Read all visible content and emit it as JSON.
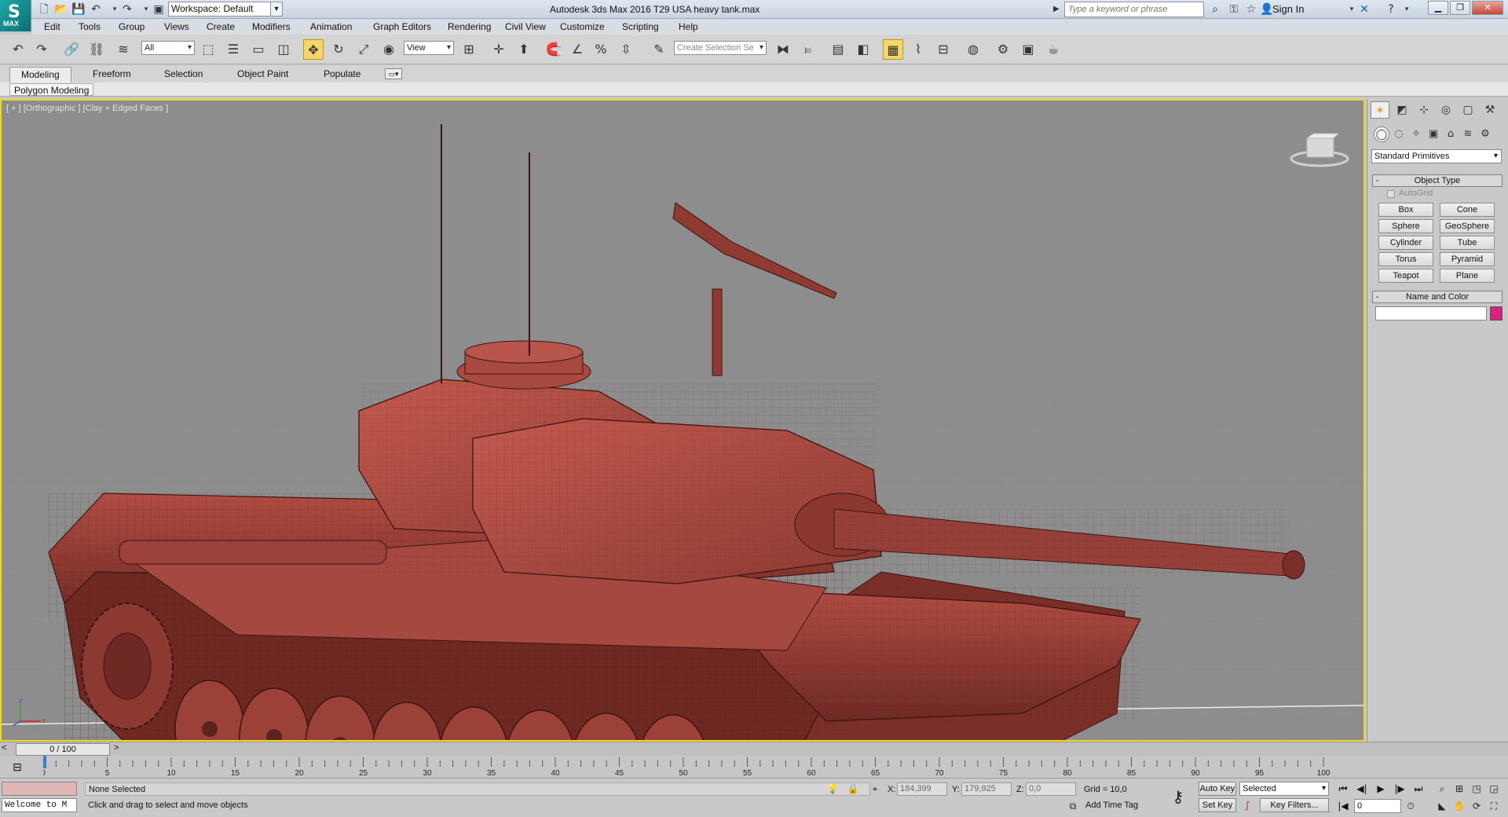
{
  "title_bar": {
    "app_logo": "MAX",
    "workspace": "Workspace: Default",
    "window_title": "Autodesk 3ds Max 2016      T29 USA heavy tank.max",
    "search_placeholder": "Type a keyword or phrase",
    "sign_in": "Sign In"
  },
  "menu": [
    "Edit",
    "Tools",
    "Group",
    "Views",
    "Create",
    "Modifiers",
    "Animation",
    "Graph Editors",
    "Rendering",
    "Civil View",
    "Customize",
    "Scripting",
    "Help"
  ],
  "toolbar": {
    "selection_filter": "All",
    "ref_coord": "View",
    "selection_set_placeholder": "Create Selection Se"
  },
  "ribbon": {
    "tabs": [
      "Modeling",
      "Freeform",
      "Selection",
      "Object Paint",
      "Populate"
    ],
    "active_tab": "Modeling",
    "panel_label": "Polygon Modeling"
  },
  "viewport": {
    "label": "[ + ] [Orthographic ] [Clay + Edged Faces ]",
    "model_color": "#a8463c",
    "background": "#8d8d8d"
  },
  "command_panel": {
    "category": "Standard Primitives",
    "object_type_title": "Object Type",
    "autogrid": "AutoGrid",
    "primitives": [
      "Box",
      "Cone",
      "Sphere",
      "GeoSphere",
      "Cylinder",
      "Tube",
      "Torus",
      "Pyramid",
      "Teapot",
      "Plane"
    ],
    "name_color_title": "Name and Color",
    "object_color": "#d8237e"
  },
  "timeline": {
    "frame_display": "0 / 100",
    "prev": "<",
    "next": ">",
    "ruler_labels": [
      "0",
      "5",
      "10",
      "15",
      "20",
      "25",
      "30",
      "35",
      "40",
      "45",
      "50",
      "55",
      "60",
      "65",
      "70",
      "75",
      "80",
      "85",
      "90",
      "95",
      "100"
    ]
  },
  "status": {
    "maxscript_welcome": "Welcome to M",
    "selection": "None Selected",
    "prompt": "Click and drag to select and move objects",
    "x_label": "X:",
    "x_value": "184,399",
    "y_label": "Y:",
    "y_value": "179,925",
    "z_label": "Z:",
    "z_value": "0,0",
    "grid": "Grid = 10,0",
    "add_time_tag": "Add Time Tag",
    "auto_key": "Auto Key",
    "set_key": "Set Key",
    "key_mode": "Selected",
    "key_filters": "Key Filters...",
    "current_frame": "0"
  }
}
